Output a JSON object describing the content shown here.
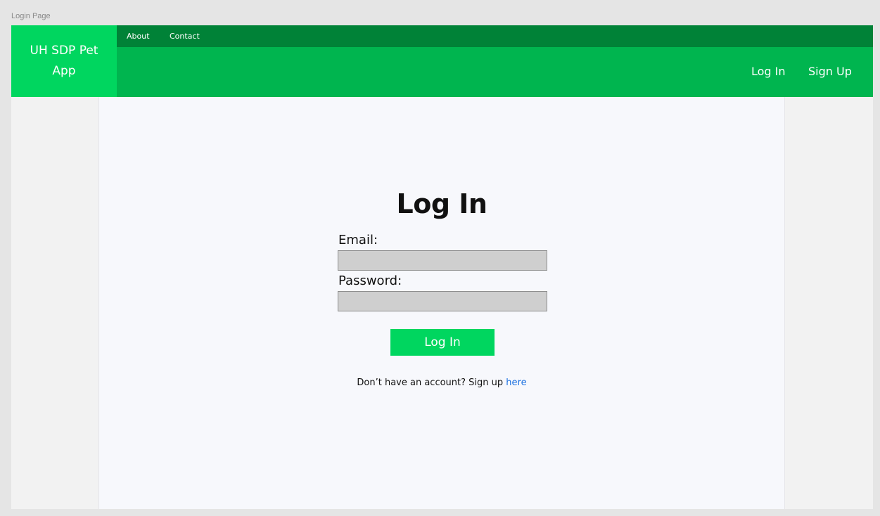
{
  "canvas": {
    "frame_label": "Login Page"
  },
  "header": {
    "brand": "UH SDP Pet App",
    "top_links": [
      "About",
      "Contact"
    ],
    "nav": {
      "login": "Log In",
      "signup": "Sign Up"
    }
  },
  "login_form": {
    "title": "Log In",
    "email_label": "Email:",
    "email_value": "",
    "password_label": "Password:",
    "password_value": "",
    "submit_label": "Log In",
    "signup_prompt": "Don’t have an account? Sign up",
    "signup_link": "here"
  },
  "colors": {
    "brand_green": "#00d65f",
    "topbar_green": "#008237",
    "nav_green": "#00b54f",
    "link_blue": "#1a6fe0"
  }
}
